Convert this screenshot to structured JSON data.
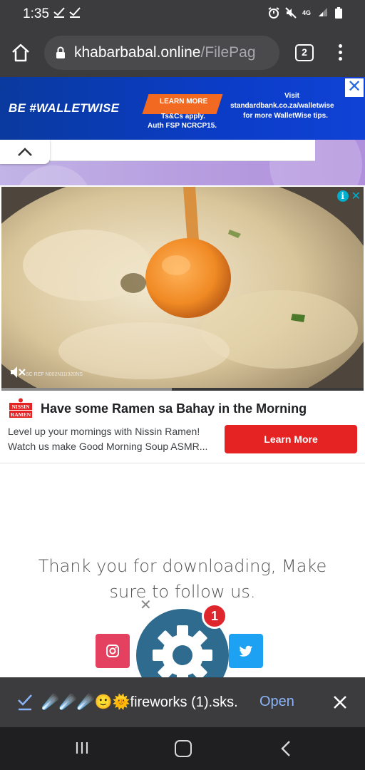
{
  "status_bar": {
    "time": "1:35",
    "network": "4G"
  },
  "browser": {
    "url_host": "khabarbabal.online",
    "url_path": "/FilePag",
    "tab_count": "2"
  },
  "banner_ad": {
    "headline": "BE #WALLETWISE",
    "cta": "LEARN MORE",
    "terms_line1": "Ts&Cs apply.",
    "terms_line2": "Auth FSP NCRCP15.",
    "visit_line1": "Visit",
    "visit_line2": "standardbank.co.za/walletwise",
    "visit_line3": "for more WalletWise tips.",
    "close": "✕"
  },
  "video_ad": {
    "ref_code": "SC REF N002N11I320NS",
    "progress": 0.47,
    "logo_line1": "NISSIN",
    "logo_line2": "RAMEN",
    "title": "Have some Ramen sa Bahay in the Morning",
    "description": "Level up your mornings with Nissin Ramen! Watch us make Good Morning Soup ASMR...",
    "button": "Learn More"
  },
  "page": {
    "thank_you_line1": "Thank you for downloading, Make",
    "thank_you_line2": "sure to follow us.",
    "small_close": "✕",
    "notification_count": "1"
  },
  "download_bar": {
    "file_name": "☄️☄️☄️🙂🌞fireworks (1).sks.",
    "open_label": "Open"
  },
  "colors": {
    "chrome": "#3c3c3e",
    "banner_blue": "#0b3cc7",
    "cta_orange": "#f26a21",
    "ad_red": "#e52323",
    "link_blue": "#8ab4f8"
  }
}
